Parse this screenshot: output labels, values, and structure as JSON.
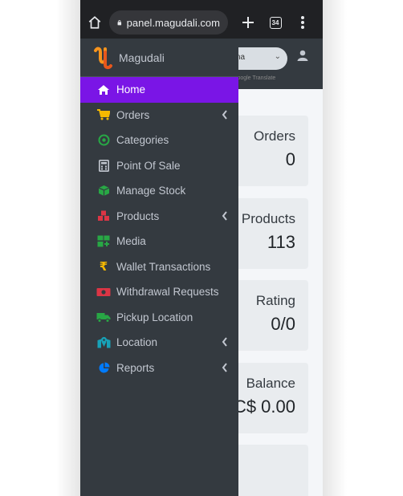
{
  "browser": {
    "url": "panel.magudali.com",
    "tab_count": "34"
  },
  "header": {
    "language_select": "na",
    "powered_by": "Google Translate"
  },
  "brand": {
    "name": "Magudali"
  },
  "nav": {
    "items": [
      {
        "label": "Home",
        "icon": "home-icon",
        "active": true,
        "has_submenu": false
      },
      {
        "label": "Orders",
        "icon": "cart-icon",
        "active": false,
        "has_submenu": true
      },
      {
        "label": "Categories",
        "icon": "target-icon",
        "active": false,
        "has_submenu": false
      },
      {
        "label": "Point Of Sale",
        "icon": "calculator-icon",
        "active": false,
        "has_submenu": false
      },
      {
        "label": "Manage Stock",
        "icon": "box-icon",
        "active": false,
        "has_submenu": false
      },
      {
        "label": "Products",
        "icon": "cubes-icon",
        "active": false,
        "has_submenu": true
      },
      {
        "label": "Media",
        "icon": "media-icon",
        "active": false,
        "has_submenu": false
      },
      {
        "label": "Wallet Transactions",
        "icon": "rupee-icon",
        "active": false,
        "has_submenu": false
      },
      {
        "label": "Withdrawal Requests",
        "icon": "money-icon",
        "active": false,
        "has_submenu": false
      },
      {
        "label": "Pickup Location",
        "icon": "truck-icon",
        "active": false,
        "has_submenu": false
      },
      {
        "label": "Location",
        "icon": "map-icon",
        "active": false,
        "has_submenu": true
      },
      {
        "label": "Reports",
        "icon": "pie-chart-icon",
        "active": false,
        "has_submenu": true
      }
    ]
  },
  "cards": [
    {
      "label": "Orders",
      "value": "0"
    },
    {
      "label": "Products",
      "value": "113"
    },
    {
      "label": "Rating",
      "value": "0/0"
    },
    {
      "label": "Balance",
      "value": "C$ 0.00"
    },
    {
      "label": "",
      "value": ""
    }
  ],
  "colors": {
    "sidebar_bg": "#343a40",
    "active_bg": "#7a15e6",
    "card_bg": "#e9ecef"
  }
}
